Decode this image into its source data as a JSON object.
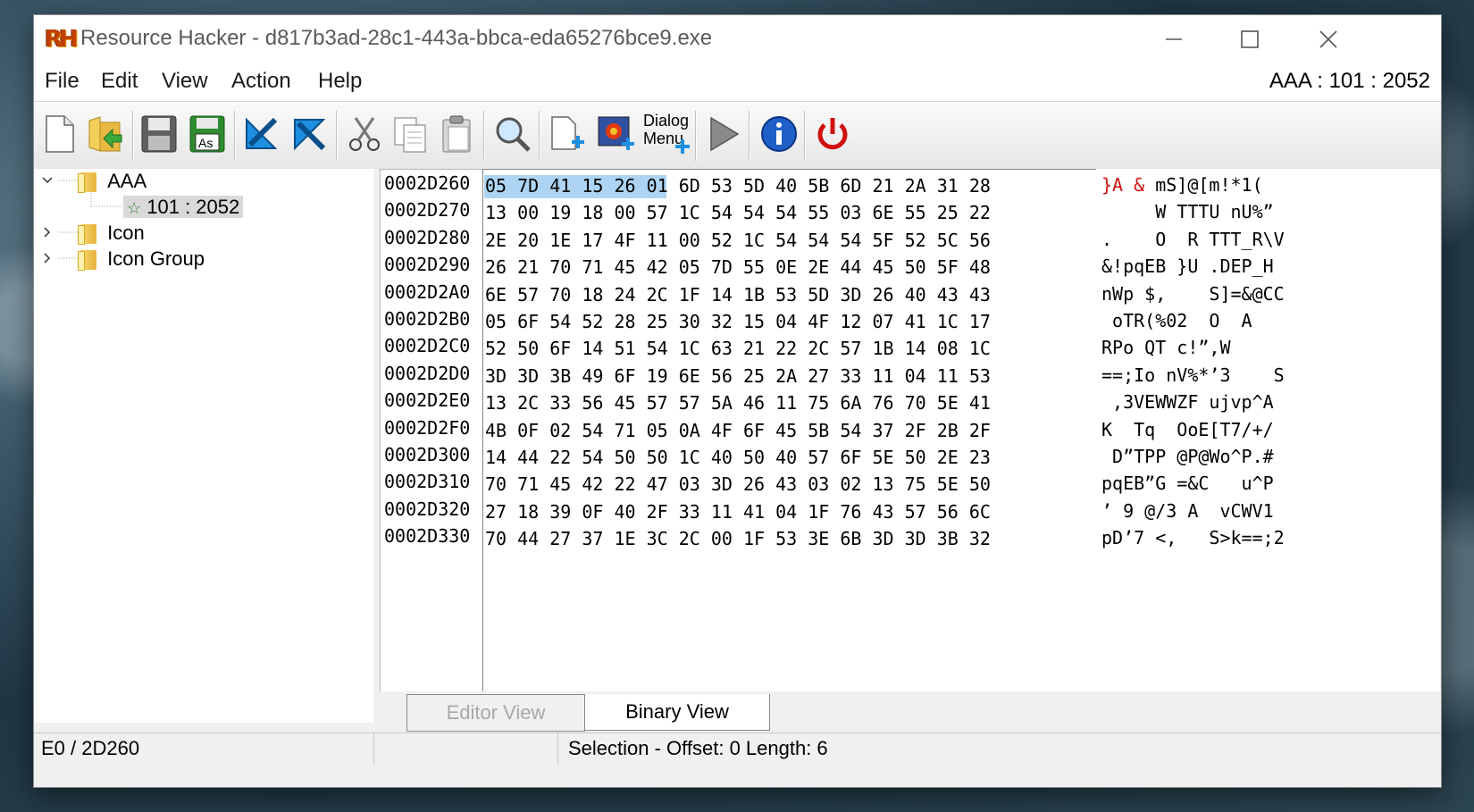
{
  "window": {
    "title": "Resource Hacker - d817b3ad-28c1-443a-bbca-eda65276bce9.exe",
    "logo_text": "RH"
  },
  "menu": [
    "File",
    "Edit",
    "View",
    "Action",
    "Help"
  ],
  "resource_id": "AAA : 101 : 2052",
  "toolbar": {
    "icons": [
      "new-file-icon",
      "open-folder-icon",
      "save-icon",
      "save-as-icon",
      "back-arrow-icon",
      "forward-arrow-icon",
      "cut-icon",
      "copy-icon",
      "paste-icon",
      "search-icon",
      "add-resource-icon",
      "add-image-icon",
      "dialog-menu-icon",
      "run-script-icon",
      "info-icon",
      "power-icon"
    ],
    "dialog_menu_label_1": "Dialog",
    "dialog_menu_label_2": "Menu"
  },
  "tree": {
    "items": [
      {
        "label": "AAA",
        "expanded": true
      },
      {
        "label": "101 : 2052",
        "selected": true
      },
      {
        "label": "Icon",
        "expanded": false
      },
      {
        "label": "Icon Group",
        "expanded": false
      }
    ]
  },
  "hex": {
    "offsets": [
      "0002D260",
      "0002D270",
      "0002D280",
      "0002D290",
      "0002D2A0",
      "0002D2B0",
      "0002D2C0",
      "0002D2D0",
      "0002D2E0",
      "0002D2F0",
      "0002D300",
      "0002D310",
      "0002D320",
      "0002D330"
    ],
    "rows": [
      "05 7D 41 15 26 01 6D 53 5D 40 5B 6D 21 2A 31 28",
      "13 00 19 18 00 57 1C 54 54 54 55 03 6E 55 25 22",
      "2E 20 1E 17 4F 11 00 52 1C 54 54 54 5F 52 5C 56",
      "26 21 70 71 45 42 05 7D 55 0E 2E 44 45 50 5F 48",
      "6E 57 70 18 24 2C 1F 14 1B 53 5D 3D 26 40 43 43",
      "05 6F 54 52 28 25 30 32 15 04 4F 12 07 41 1C 17",
      "52 50 6F 14 51 54 1C 63 21 22 2C 57 1B 14 08 1C",
      "3D 3D 3B 49 6F 19 6E 56 25 2A 27 33 11 04 11 53",
      "13 2C 33 56 45 57 57 5A 46 11 75 6A 76 70 5E 41",
      "4B 0F 02 54 71 05 0A 4F 6F 45 5B 54 37 2F 2B 2F",
      "14 44 22 54 50 50 1C 40 50 40 57 6F 5E 50 2E 23",
      "70 71 45 42 22 47 03 3D 26 43 03 02 13 75 5E 50",
      "27 18 39 0F 40 2F 33 11 41 04 1F 76 43 57 56 6C",
      "70 44 27 37 1E 3C 2C 00 1F 53 3E 6B 3D 3D 3B 32"
    ],
    "ascii_first_red": "}A &",
    "ascii_first_rest": " mS]@[m!*1(",
    "ascii": [
      "     W TTTU nU%”",
      ".    O  R TTT_R\\V",
      "&!pqEB }U .DEP_H",
      "nWp $,    S]=&@CC",
      " oTR(%02  O  A",
      "RPo QT c!”,W",
      "==;Io nV%*’3    S",
      " ,3VEWWZF ujvp^A",
      "K  Tq  OoE[T7/+/",
      " D”TPP @P@Wo^P.#",
      "pqEB”G =&C   u^P",
      "’ 9 @/3 A  vCWV1",
      "pD’7 <,   S>k==;2"
    ]
  },
  "tabs": {
    "editor_view": "Editor View",
    "binary_view": "Binary View"
  },
  "status": {
    "position": "E0 / 2D260",
    "selection": "Selection - Offset: 0 Length: 6"
  }
}
